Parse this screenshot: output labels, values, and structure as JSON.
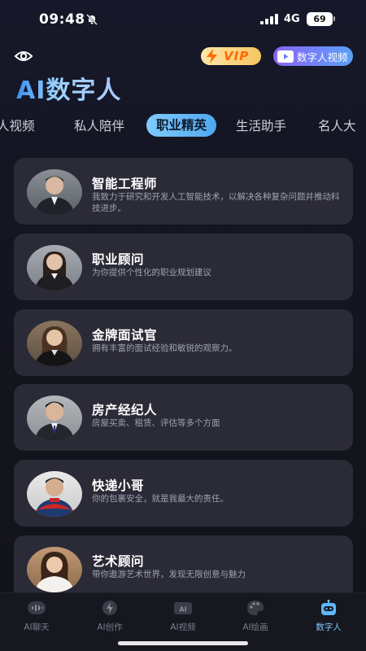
{
  "status_bar": {
    "time": "09:48",
    "network": "4G",
    "battery": "69"
  },
  "header": {
    "eye_icon": "eye-icon",
    "vip_label": "VIP",
    "video_button_label": "数字人视频",
    "title": "AI数字人"
  },
  "tabs": [
    {
      "label": "人视频"
    },
    {
      "label": "私人陪伴"
    },
    {
      "label": "职业精英",
      "active": true
    },
    {
      "label": "生活助手"
    },
    {
      "label": "名人大"
    }
  ],
  "cards": [
    {
      "title": "智能工程师",
      "desc": "我致力于研究和开发人工智能技术，以解决各种复杂问题并推动科技进步。"
    },
    {
      "title": "职业顾问",
      "desc": "为你提供个性化的职业规划建议"
    },
    {
      "title": "金牌面试官",
      "desc": "拥有丰富的面试经验和敏锐的观察力。"
    },
    {
      "title": "房产经纪人",
      "desc": "房屋买卖、租赁、评估等多个方面"
    },
    {
      "title": "快递小哥",
      "desc": "你的包裹安全，就是我最大的责任。"
    },
    {
      "title": "艺术顾问",
      "desc": "带你遨游艺术世界，发现无限创意与魅力"
    }
  ],
  "bottom_nav": [
    {
      "label": "AI聊天",
      "icon": "voice-wave-icon"
    },
    {
      "label": "AI创作",
      "icon": "lightning-icon"
    },
    {
      "label": "AI视频",
      "icon": "ai-video-icon"
    },
    {
      "label": "AI绘画",
      "icon": "palette-icon"
    },
    {
      "label": "数字人",
      "icon": "robot-icon",
      "active": true
    }
  ],
  "colors": {
    "accent": "#4fa8ee",
    "card_bg": "#2b2b37",
    "vip_text": "#ff6a00"
  }
}
